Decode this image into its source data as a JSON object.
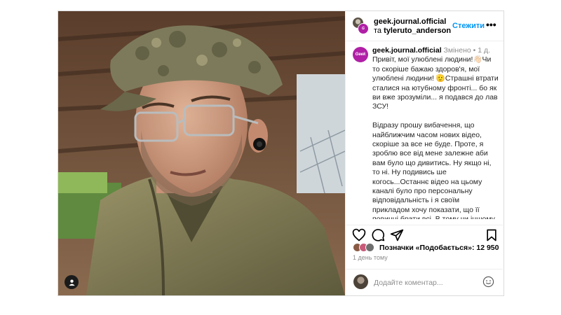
{
  "post": {
    "media": {
      "tag_icon": "user-tag-icon"
    },
    "header": {
      "username": "geek.journal.official",
      "connector": "та",
      "collaborator": "tyleruto_anderson",
      "follow_label": "Стежити",
      "more_label": "•••"
    },
    "caption": {
      "avatar_text": "Geek",
      "username": "geek.journal.official",
      "edited": "Змінено",
      "dot": "•",
      "age": "1 д.",
      "paragraph1": "Привіт, мої улюблені людини!👋🏻Чи то скоріше бажаю здоров'я, мої улюблені людини! 🫡Страшні втрати сталися на ютубному фронті... бо як ви вже зрозуміли... я подався до лав ЗСУ!",
      "paragraph2": "Відразу прошу вибачення, що найближчим часом нових відео, скоріше за все не буде. Проте, я зроблю все від мене залежне аби вам було що дивитись. Ну якщо ні, то ні. Ну подивись ше когось...Останнє відео на цьому каналі було про персональну відповідальність і я своїм прикладом хочу показати, що її повинні брати всі. В тому чи іншому вигляді. Я вважаю, якщо ви не працюєте на українську перемогу в будь якому вигляді, то ви прямо"
    },
    "actions": {
      "like_icon": "heart-icon",
      "comment_icon": "comment-icon",
      "share_icon": "send-icon",
      "save_icon": "bookmark-icon"
    },
    "likes_text": "Позначки «Подобається»: 12 950",
    "date": "1 день тому",
    "comment_placeholder": "Додайте коментар...",
    "emoji_icon": "smiley-icon"
  },
  "colors": {
    "accent": "#0095f6",
    "brand": "#b01fa6",
    "muted": "#8e8e8e",
    "border": "#dbdbdb"
  }
}
